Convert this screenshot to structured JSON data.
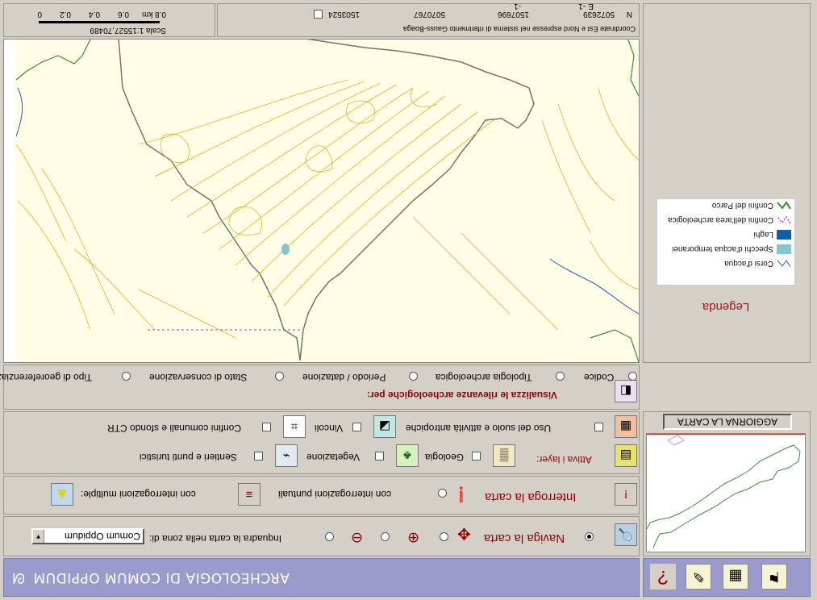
{
  "header": {
    "title": "ARCHEOLOGIA DI COMUM OPPIDUM"
  },
  "navigation": {
    "navigate_label": "Naviga la carta",
    "frame_label": "Inquadra la carta nella zona di:",
    "zone_selected": "Comum Oppidum",
    "navigate_selected": true
  },
  "query": {
    "title": "Interroga la carta",
    "point_label": "con interrogazioni puntuali",
    "multi_label": "con interrogazioni multiple:"
  },
  "layers": {
    "activate_label": "Attiva i layer:",
    "items": [
      {
        "label": "Uso del suolo e attività antropiche"
      },
      {
        "label": "Vincoli"
      },
      {
        "label": "Confini comunali e sfondo CTR"
      },
      {
        "label": "Geologia"
      },
      {
        "label": "Vegetazione"
      },
      {
        "label": "Sentieri e punti turistici"
      }
    ]
  },
  "visualize": {
    "title": "Visualizza le rilevanze archeologiche per:",
    "options": [
      {
        "label": "Codice"
      },
      {
        "label": "Tipologia archeologica"
      },
      {
        "label": "Periodo / datazione"
      },
      {
        "label": "Stato di conservazione"
      },
      {
        "label": "Tipo di georeferenziazione"
      }
    ]
  },
  "overview": {
    "update_button": "AGGIORNA LA CARTA"
  },
  "legend": {
    "title": "Legenda",
    "items": [
      {
        "label": "Confini del Parco",
        "color": "#3a8a3a"
      },
      {
        "label": "Confini dell'area archeologica",
        "color": "#a040c0"
      },
      {
        "label": "Laghi",
        "color": "#1060b0"
      },
      {
        "label": "Specchi d'acqua temporanei",
        "color": "#80c8d0"
      },
      {
        "label": "Corsi d'acqua",
        "color": "#2060c0"
      }
    ]
  },
  "scale": {
    "label": "Scala 1:15527,70489",
    "ticks": [
      "0",
      "0.2",
      "0.4",
      "0.6",
      "0.8 km"
    ]
  },
  "coords": {
    "caption": "Coordinate Est e Nord espresse nel sistema di riferimento Gauss-Boaga",
    "values": [
      "1503524",
      "5070767",
      "1507696",
      "5072639"
    ],
    "n_label": "N",
    "e_label": "E",
    "e_value": "-1",
    "n_value": "-1"
  },
  "colors": {
    "title_bar": "#9a9acd",
    "contour": "#d9b32a",
    "park_border": "#6a7a6a",
    "map_bg": "#fffde6"
  }
}
